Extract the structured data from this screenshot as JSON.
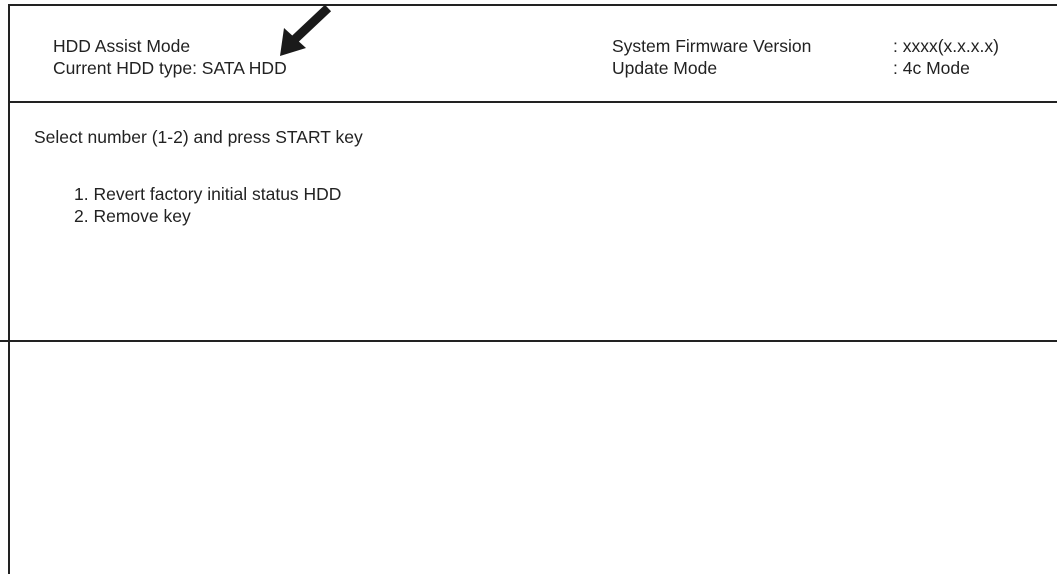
{
  "header": {
    "mode_title": "HDD Assist Mode",
    "hdd_type": "Current HDD type: SATA HDD",
    "firmware_label": "System Firmware Version",
    "firmware_value": ": xxxx(x.x.x.x)",
    "update_label": "Update Mode",
    "update_value": ": 4c Mode"
  },
  "main": {
    "prompt": "Select number (1-2) and press START key",
    "options": [
      {
        "label": "1. Revert factory initial status HDD"
      },
      {
        "label": "2. Remove key"
      }
    ]
  },
  "annotation": {
    "icon": "arrow-down-left-icon",
    "color": "#1a1a1a"
  }
}
